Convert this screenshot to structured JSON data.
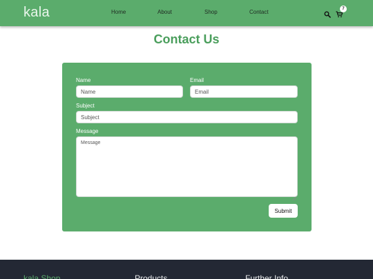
{
  "navbar": {
    "brand": "kala",
    "links": [
      "Home",
      "About",
      "Shop",
      "Contact"
    ],
    "icons": {
      "search": "search-icon",
      "cart": "cart-icon"
    },
    "cart_count": "7"
  },
  "page": {
    "title": "Contact Us"
  },
  "form": {
    "name_label": "Name",
    "name_placeholder": "Name",
    "email_label": "Email",
    "email_placeholder": "Email",
    "subject_label": "Subject",
    "subject_placeholder": "Subject",
    "message_label": "Message",
    "message_placeholder": "Message",
    "submit_label": "Submit"
  },
  "footer": {
    "brand": "kala Shop",
    "col2": "Products",
    "col3": "Further Info"
  },
  "colors": {
    "brand_green": "#5bac6c",
    "title_green": "#4a9e5c",
    "footer_bg": "#232834",
    "white": "#ffffff"
  }
}
